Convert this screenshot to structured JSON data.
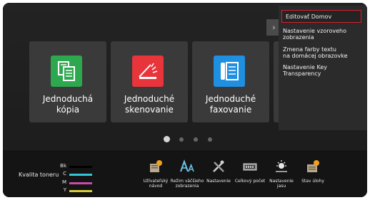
{
  "tiles": [
    {
      "label": "Jednoduchá\nkópia",
      "color": "#2ea84e",
      "icon": "copy-documents-icon"
    },
    {
      "label": "Jednoduché\nskenovanie",
      "color": "#e8343b",
      "icon": "scanner-icon"
    },
    {
      "label": "Jednoduché\nfaxovanie",
      "color": "#1f8fe0",
      "icon": "fax-phone-icon"
    }
  ],
  "menu": {
    "items": [
      "Editovať Domov",
      "Nastavenie vzoroveho\nzobrazenia",
      "Zmena farby textu\nna domácej obrazovke",
      "Nastavenie Key\nTransparency"
    ],
    "selected_color": "#d81e2e"
  },
  "expand_glyph": "›",
  "page_indicator": {
    "count": 4,
    "active": 0
  },
  "toner": {
    "label": "Kvalita toneru",
    "channels": [
      {
        "name": "Bk",
        "color": "#000000"
      },
      {
        "name": "C",
        "color": "#33c6d6"
      },
      {
        "name": "M",
        "color": "#c84ca8"
      },
      {
        "name": "Y",
        "color": "#d6cc3a"
      }
    ]
  },
  "bottom_items": [
    {
      "label": "Užívateľský\nnávod",
      "icon": "user-guide-book-icon"
    },
    {
      "label": "Režim väčšieho\nzobrazenia",
      "icon": "large-text-aa-icon"
    },
    {
      "label": "Nastavenie",
      "icon": "settings-tools-icon"
    },
    {
      "label": "Celkový počet",
      "icon": "counter-display-icon"
    },
    {
      "label": "Nastavenie\njasu",
      "icon": "brightness-sun-icon"
    },
    {
      "label": "Stav úlohy",
      "icon": "job-status-icon"
    }
  ]
}
